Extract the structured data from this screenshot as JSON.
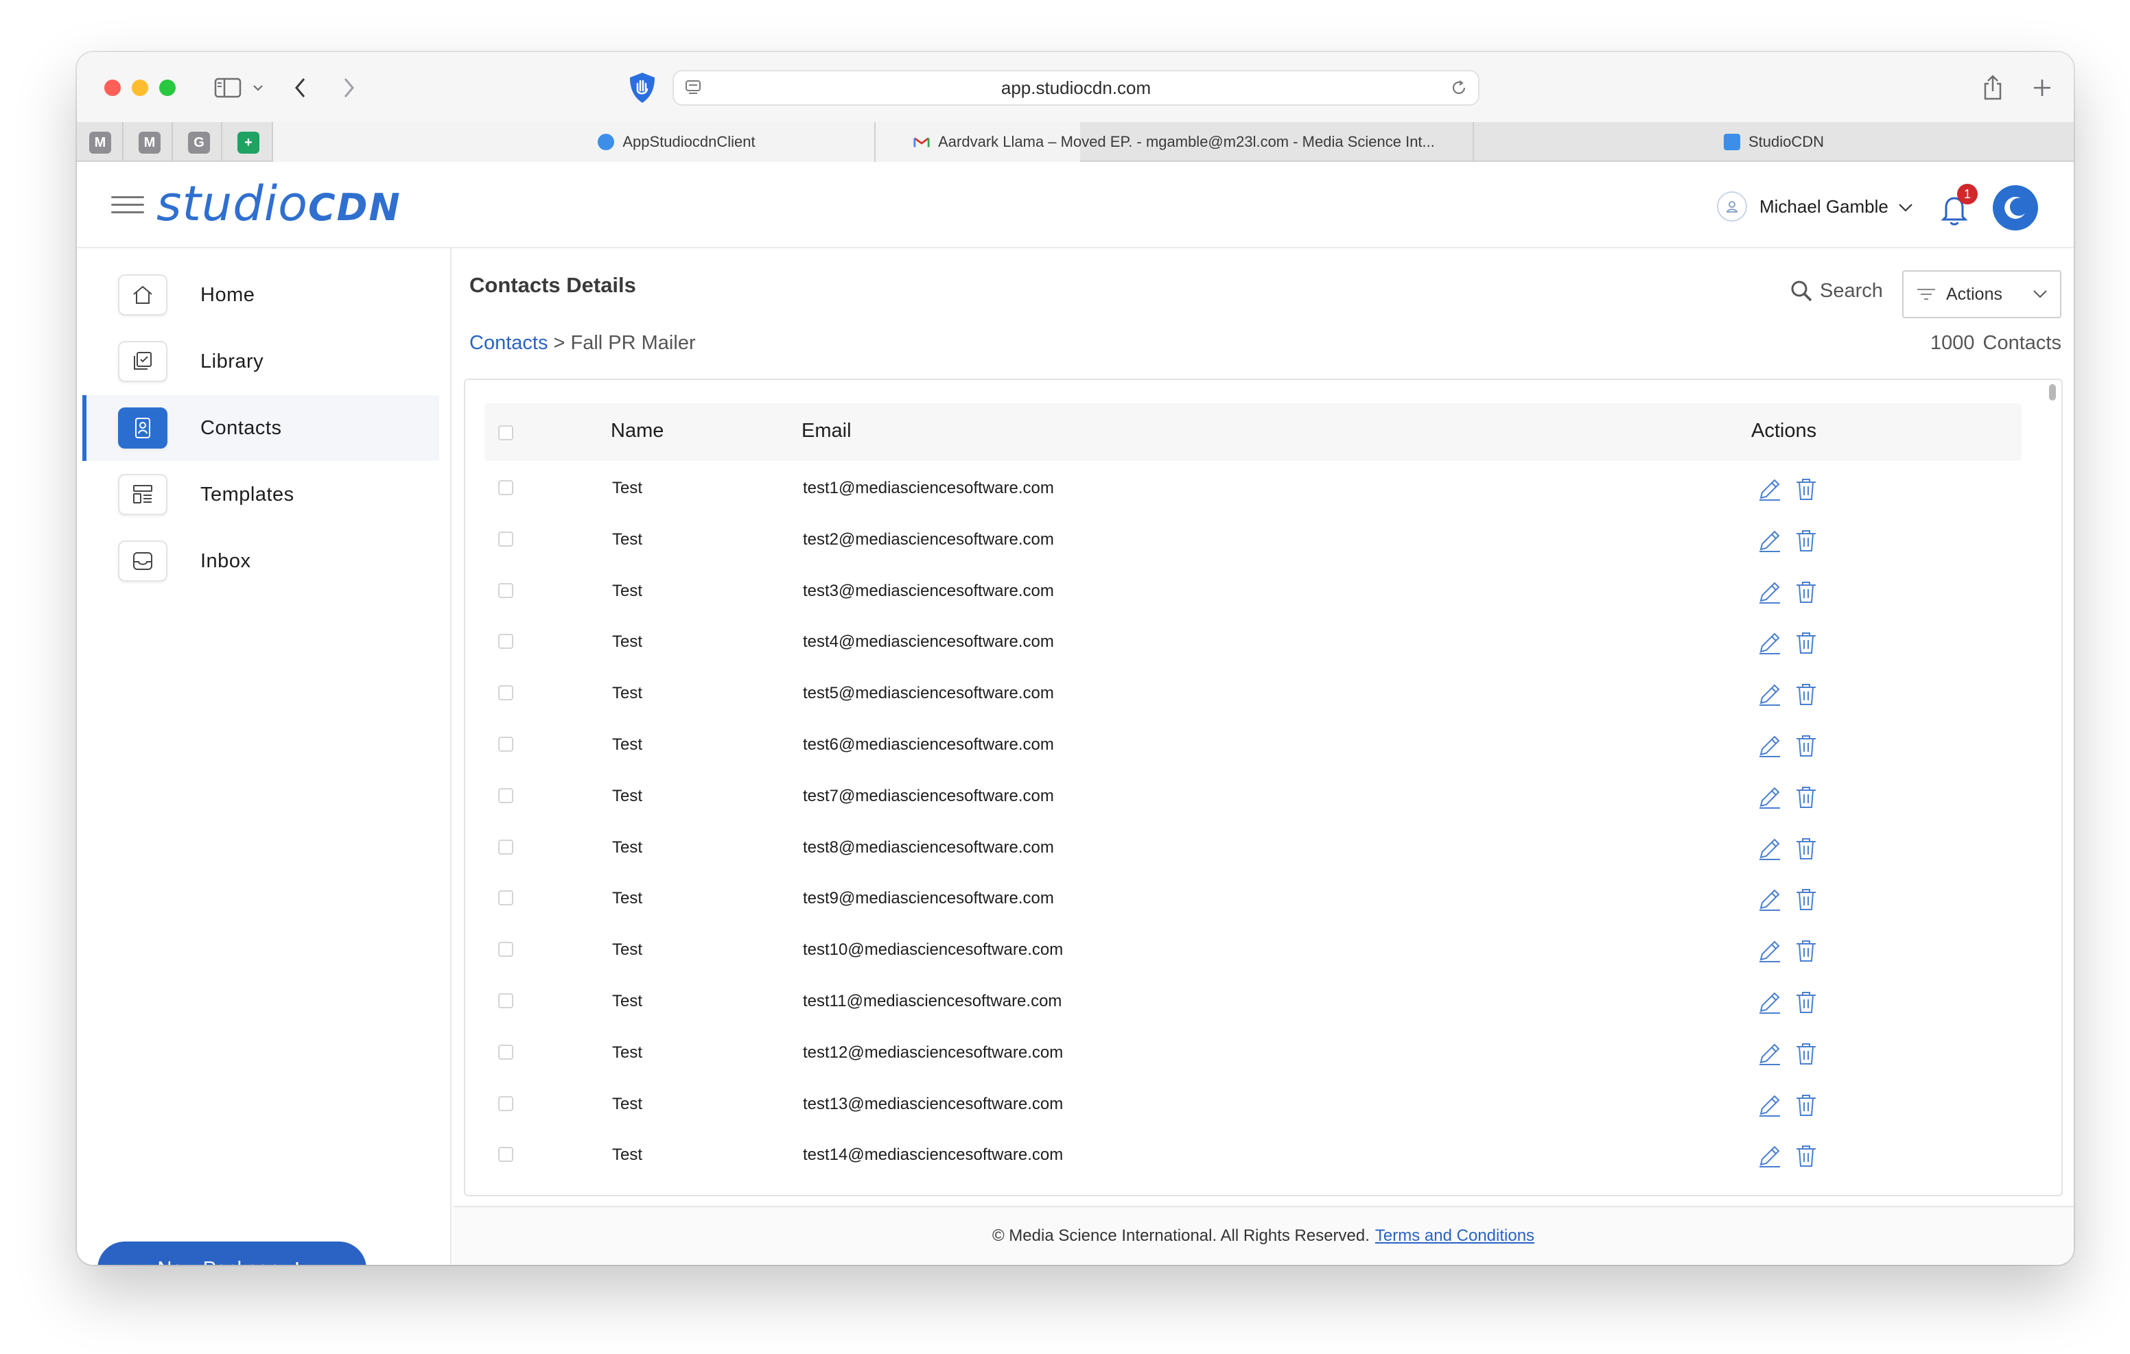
{
  "browser": {
    "url": "app.studiocdn.com",
    "pinned_tabs": [
      {
        "letter": "M",
        "color": "#8e8e93"
      },
      {
        "letter": "M",
        "color": "#8e8e93"
      },
      {
        "letter": "G",
        "color": "#8e8e93"
      },
      {
        "letter": "+",
        "color": "#1ea362"
      }
    ],
    "tabs": [
      {
        "title": "AppStudiocdnClient",
        "active": true
      },
      {
        "title": "Aardvark Llama – Moved EP. - mgamble@m23l.com - Media Science Int...",
        "active": false
      },
      {
        "title": "StudioCDN",
        "active": false
      }
    ]
  },
  "header": {
    "logo_part1": "studio",
    "logo_part2": "CDN",
    "user_name": "Michael Gamble",
    "notification_count": "1"
  },
  "sidebar": {
    "items": [
      {
        "label": "Home",
        "icon": "home-icon",
        "active": false
      },
      {
        "label": "Library",
        "icon": "library-icon",
        "active": false
      },
      {
        "label": "Contacts",
        "icon": "contacts-icon",
        "active": true
      },
      {
        "label": "Templates",
        "icon": "templates-icon",
        "active": false
      },
      {
        "label": "Inbox",
        "icon": "inbox-icon",
        "active": false
      }
    ],
    "new_package_label": "New Package"
  },
  "main": {
    "title": "Contacts Details",
    "search_label": "Search",
    "actions_label": "Actions",
    "breadcrumb_root": "Contacts",
    "breadcrumb_sep": ">",
    "breadcrumb_current": "Fall PR Mailer",
    "count_value": "1000",
    "count_label": "Contacts",
    "columns": {
      "name": "Name",
      "email": "Email",
      "actions": "Actions"
    },
    "rows": [
      {
        "name": "Test",
        "email": "test1@mediasciencesoftware.com"
      },
      {
        "name": "Test",
        "email": "test2@mediasciencesoftware.com"
      },
      {
        "name": "Test",
        "email": "test3@mediasciencesoftware.com"
      },
      {
        "name": "Test",
        "email": "test4@mediasciencesoftware.com"
      },
      {
        "name": "Test",
        "email": "test5@mediasciencesoftware.com"
      },
      {
        "name": "Test",
        "email": "test6@mediasciencesoftware.com"
      },
      {
        "name": "Test",
        "email": "test7@mediasciencesoftware.com"
      },
      {
        "name": "Test",
        "email": "test8@mediasciencesoftware.com"
      },
      {
        "name": "Test",
        "email": "test9@mediasciencesoftware.com"
      },
      {
        "name": "Test",
        "email": "test10@mediasciencesoftware.com"
      },
      {
        "name": "Test",
        "email": "test11@mediasciencesoftware.com"
      },
      {
        "name": "Test",
        "email": "test12@mediasciencesoftware.com"
      },
      {
        "name": "Test",
        "email": "test13@mediasciencesoftware.com"
      },
      {
        "name": "Test",
        "email": "test14@mediasciencesoftware.com"
      }
    ]
  },
  "footer": {
    "text": "© Media Science International. All Rights Reserved.",
    "terms_label": "Terms and Conditions"
  },
  "colors": {
    "accent": "#2a63c4",
    "badge": "#d0282b"
  }
}
